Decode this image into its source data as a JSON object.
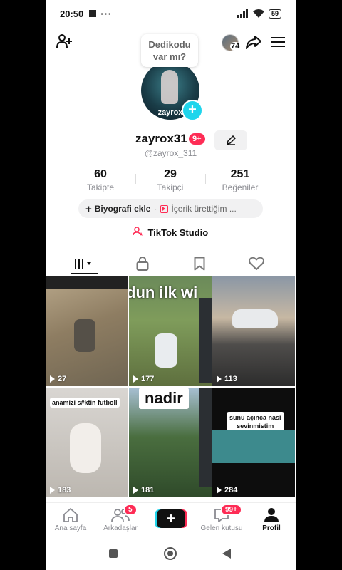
{
  "status": {
    "time": "20:50",
    "battery": "59",
    "dots": "···"
  },
  "topbar": {
    "avatar_count": "74"
  },
  "bubble": {
    "line1": "Dedikodu",
    "line2": "var mı?"
  },
  "profile": {
    "avatar_label": "zayrox",
    "display_name": "zayrox31",
    "badge": "9+",
    "handle": "@zayrox_311"
  },
  "stats": [
    {
      "value": "60",
      "label": "Takipte"
    },
    {
      "value": "29",
      "label": "Takipçi"
    },
    {
      "value": "251",
      "label": "Beğeniler"
    }
  ],
  "bio": {
    "add_label": "Biyografi ekle",
    "plus": "+",
    "more": "İçerik ürettiğim ..."
  },
  "studio": {
    "label": "TikTok Studio"
  },
  "videos": [
    {
      "views": "27"
    },
    {
      "views": "177",
      "caption": "dun ilk wi"
    },
    {
      "views": "113"
    },
    {
      "views": "183",
      "caption": "anamizi s#ktin futboll"
    },
    {
      "views": "181",
      "caption": "nadir"
    },
    {
      "views": "284",
      "caption_line1": "sunu açınca nasi",
      "caption_line2": "sevinmistim"
    }
  ],
  "nav": {
    "home": "Ana sayfa",
    "friends": "Arkadaşlar",
    "friends_badge": "5",
    "create": "+",
    "inbox": "Gelen kutusu",
    "inbox_badge": "99+",
    "profile": "Profil"
  },
  "colors": {
    "accent": "#fe2c55",
    "cyan": "#20d5ec"
  }
}
